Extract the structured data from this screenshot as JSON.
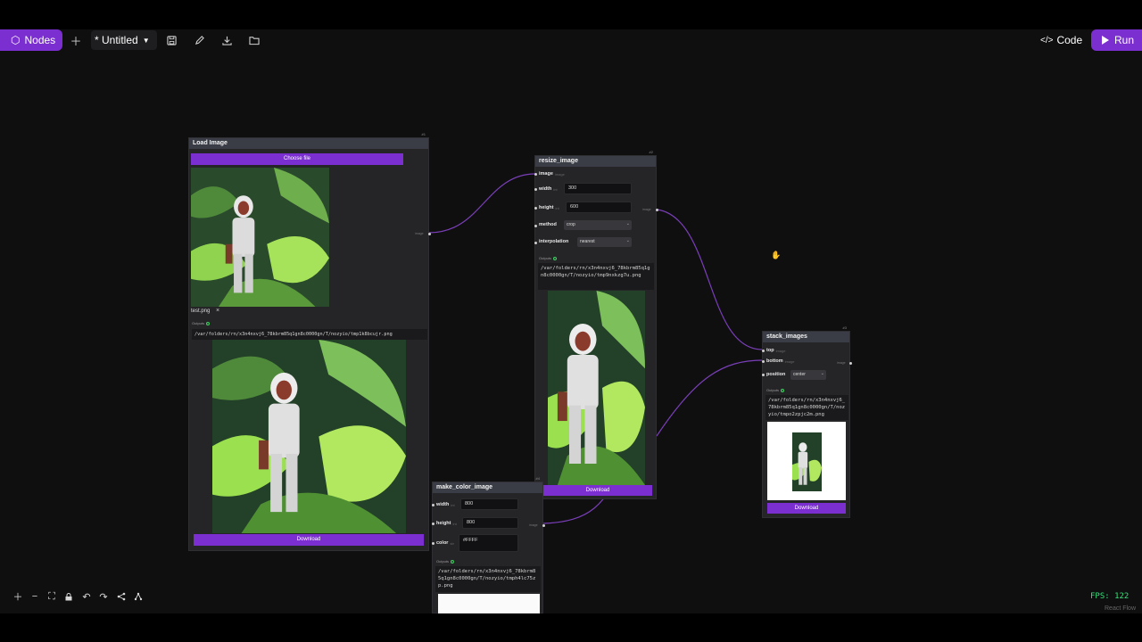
{
  "toolbar": {
    "nodes_label": "Nodes",
    "add_icon": "plus-icon",
    "title": "* Untitled",
    "save_icon": "save-icon",
    "edit_icon": "pencil-icon",
    "download_icon": "download-icon",
    "open_icon": "folder-icon",
    "code_label": "Code",
    "run_label": "Run",
    "accent_color": "#7b2fd0"
  },
  "nodes": {
    "load_image": {
      "id": "#1",
      "title": "Load Image",
      "choose_file": "Choose file",
      "file_name": "test.png",
      "remove": "×",
      "outputs_label": "Outputs",
      "output_path": "/var/folders/rn/x3n4nxvj6_78kbrm85q1gn8c0000gn/T/nozyio/tmp1k8bcujr.png",
      "download": "Download",
      "out_handle": "image"
    },
    "resize_image": {
      "id": "#2",
      "title": "resize_image",
      "image_label": "image",
      "image_type": "image",
      "width_label": "width",
      "width_type": "int",
      "width_value": "300",
      "height_label": "height",
      "height_type": "int",
      "height_value": "600",
      "method_label": "method",
      "method_value": "crop",
      "interp_label": "interpolation",
      "interp_value": "nearest",
      "outputs_label": "Outputs",
      "output_path": "/var/folders/rn/x3n4nxvj6_78kbrm85q1gn8c0000gn/T/nozyio/tmp9nxkzg7u.png",
      "download": "Download",
      "out_handle": "image"
    },
    "stack_images": {
      "id": "#3",
      "title": "stack_images",
      "top_label": "top",
      "top_type": "image",
      "bottom_label": "bottom",
      "bottom_type": "image",
      "position_label": "position",
      "position_value": "center",
      "outputs_label": "Outputs",
      "output_path": "/var/folders/rn/x3n4nxvj6_78kbrm85q1gn8c0000gn/T/nozyio/tmpo2zpjc2m.png",
      "download": "Download",
      "out_handle": "image"
    },
    "make_color_image": {
      "id": "#4",
      "title": "make_color_image",
      "width_label": "width",
      "width_type": "int",
      "width_value": "800",
      "height_label": "height",
      "height_type": "int",
      "height_value": "800",
      "color_label": "color",
      "color_type": "str",
      "color_value": "#FFFF",
      "outputs_label": "Outputs",
      "output_path": "/var/folders/rn/x3n4nxvj6_78kbrm85q1gn8c0000gn/T/nozyio/tmph4lc75zp.png",
      "out_handle": "image"
    }
  },
  "controls": [
    "plus-icon",
    "minus-icon",
    "fit-view-icon",
    "lock-icon",
    "undo-icon",
    "redo-icon",
    "share-icon",
    "layout-icon"
  ],
  "status": {
    "fps": "FPS: 122",
    "attribution": "React Flow"
  }
}
